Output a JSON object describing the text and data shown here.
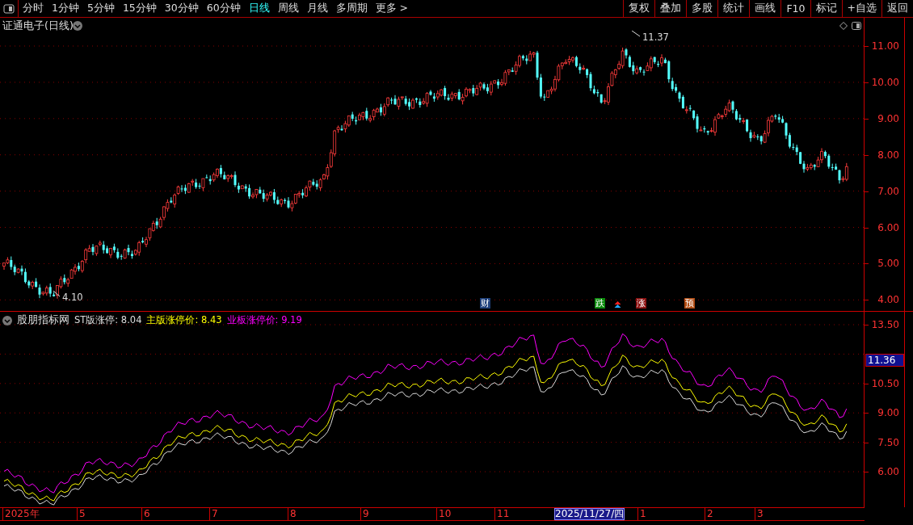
{
  "toolbar": {
    "periods": [
      {
        "label": "分时",
        "selected": false
      },
      {
        "label": "1分钟",
        "selected": false
      },
      {
        "label": "5分钟",
        "selected": false
      },
      {
        "label": "15分钟",
        "selected": false
      },
      {
        "label": "30分钟",
        "selected": false
      },
      {
        "label": "60分钟",
        "selected": false
      },
      {
        "label": "日线",
        "selected": true
      },
      {
        "label": "周线",
        "selected": false
      },
      {
        "label": "月线",
        "selected": false
      },
      {
        "label": "多周期",
        "selected": false
      },
      {
        "label": "更多 >",
        "selected": false
      }
    ],
    "buttons": [
      "复权",
      "叠加",
      "多股",
      "统计",
      "画线",
      "F10",
      "标记",
      "+自选",
      "返回"
    ]
  },
  "price_panel": {
    "title": "证通电子(日线)",
    "y_ticks": [
      "11.00",
      "10.00",
      "9.00",
      "8.00",
      "7.00",
      "6.00",
      "5.00",
      "4.00"
    ],
    "annotations": [
      {
        "kind": "low",
        "text": "4.10"
      },
      {
        "kind": "high",
        "text": "11.37"
      }
    ],
    "markers": [
      {
        "text": "财",
        "color": "#1e3f7a"
      },
      {
        "text": "跌",
        "color": "#0a8a0a"
      },
      {
        "kind": "arrow"
      },
      {
        "text": "涨",
        "color": "#8a1010"
      },
      {
        "text": "预",
        "color": "#b04a10"
      }
    ]
  },
  "indicator_panel": {
    "name": "股朋指标网",
    "values": [
      {
        "label": "ST版涨停: 8.04",
        "color": "#dddddd"
      },
      {
        "label": "主版涨停价: 8.43",
        "color": "#ffff00"
      },
      {
        "label": "业板涨停价: 9.19",
        "color": "#ff00ff"
      }
    ],
    "y_ticks": [
      "13.50",
      "10.50",
      "9.00",
      "7.50",
      "6.00"
    ],
    "price_tag": "11.36"
  },
  "date_axis": {
    "labels": [
      "2025年",
      "5",
      "6",
      "7",
      "8",
      "9",
      "10",
      "11",
      "1",
      "2",
      "3"
    ],
    "cursor_date": "2025/11/27/四"
  }
}
